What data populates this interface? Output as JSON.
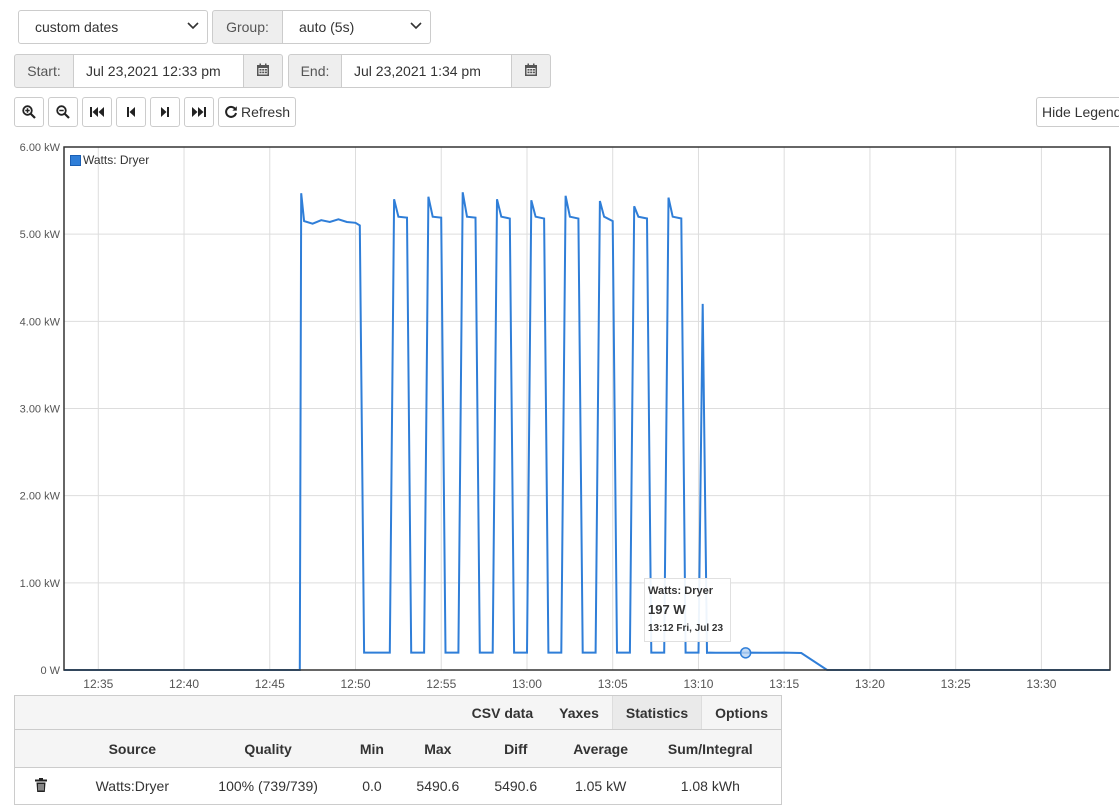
{
  "controls": {
    "range_select": "custom dates",
    "group_label": "Group:",
    "group_select": "auto (5s)",
    "start_label": "Start:",
    "start_value": "Jul 23,2021 12:33 pm",
    "end_label": "End:",
    "end_value": "Jul 23,2021 1:34 pm",
    "refresh_label": "Refresh",
    "hide_legend_label": "Hide Legend"
  },
  "icons": {
    "zoom_in": "zoom-in-icon",
    "zoom_out": "zoom-out-icon",
    "first": "skip-backward-icon",
    "prev": "step-backward-icon",
    "next": "step-forward-icon",
    "last": "skip-forward-icon",
    "refresh": "refresh-icon",
    "calendar": "calendar-icon",
    "trash": "trash-icon"
  },
  "chart_data": {
    "type": "line",
    "title": "",
    "xlabel": "",
    "ylabel": "",
    "x_ticks": [
      "12:35",
      "12:40",
      "12:45",
      "12:50",
      "12:55",
      "13:00",
      "13:05",
      "13:10",
      "13:15",
      "13:20",
      "13:25",
      "13:30"
    ],
    "y_ticks": [
      "0 W",
      "1.00 kW",
      "2.00 kW",
      "3.00 kW",
      "4.00 kW",
      "5.00 kW",
      "6.00 kW"
    ],
    "xlim": [
      "12:33",
      "13:34"
    ],
    "ylim": [
      0,
      6000
    ],
    "grid": true,
    "legend": "top-left",
    "color": "#2f7ed8",
    "series": [
      {
        "name": "Watts: Dryer",
        "x": [
          "12:33",
          "12:46:45",
          "12:46:50",
          "12:47",
          "12:47:30",
          "12:48",
          "12:48:30",
          "12:49",
          "12:49:30",
          "12:50",
          "12:50:15",
          "12:50:30",
          "12:50:40",
          "12:52",
          "12:52:15",
          "12:52:30",
          "12:53",
          "12:53:15",
          "12:53:25",
          "12:54",
          "12:54:15",
          "12:54:30",
          "12:55",
          "12:55:15",
          "12:55:25",
          "12:56",
          "12:56:15",
          "12:56:30",
          "12:57",
          "12:57:15",
          "12:57:25",
          "12:58",
          "12:58:15",
          "12:58:30",
          "12:59",
          "12:59:15",
          "12:59:25",
          "13:00",
          "13:00:15",
          "13:00:30",
          "13:01",
          "13:01:15",
          "13:01:25",
          "13:02",
          "13:02:15",
          "13:02:30",
          "13:03",
          "13:03:15",
          "13:03:25",
          "13:04",
          "13:04:15",
          "13:04:30",
          "13:05",
          "13:05:15",
          "13:05:25",
          "13:06",
          "13:06:15",
          "13:06:30",
          "13:07",
          "13:07:15",
          "13:07:25",
          "13:08",
          "13:08:15",
          "13:08:30",
          "13:09",
          "13:09:15",
          "13:09:25",
          "13:10",
          "13:10:15",
          "13:10:30",
          "13:10:40",
          "13:11",
          "13:12",
          "13:13",
          "13:14",
          "13:15",
          "13:16",
          "13:17:30",
          "13:17:40",
          "13:34"
        ],
        "y": [
          0,
          0,
          5470,
          5150,
          5120,
          5160,
          5140,
          5170,
          5140,
          5130,
          5100,
          200,
          200,
          200,
          5400,
          5200,
          5190,
          200,
          200,
          200,
          5430,
          5200,
          5190,
          200,
          200,
          200,
          5480,
          5200,
          5190,
          200,
          200,
          200,
          5400,
          5200,
          5180,
          200,
          200,
          200,
          5390,
          5200,
          5180,
          200,
          200,
          200,
          5440,
          5200,
          5180,
          200,
          200,
          200,
          5380,
          5200,
          5150,
          200,
          200,
          200,
          5320,
          5200,
          5180,
          200,
          200,
          200,
          5420,
          5200,
          5180,
          200,
          200,
          200,
          4200,
          197,
          200,
          197,
          197,
          200,
          197,
          200,
          195,
          0,
          0,
          0
        ],
        "unit": "W"
      }
    ],
    "tooltip": {
      "series": "Watts: Dryer",
      "value": "197 W",
      "time": "13:12 Fri, Jul 23",
      "x": "13:12:45",
      "y": 197
    }
  },
  "stats_panel": {
    "tabs": [
      "CSV data",
      "Yaxes",
      "Statistics",
      "Options"
    ],
    "active_tab": "Statistics",
    "columns": [
      "",
      "Source",
      "Quality",
      "Min",
      "Max",
      "Diff",
      "Average",
      "Sum/Integral"
    ],
    "rows": [
      {
        "source": "Watts:Dryer",
        "quality": "100% (739/739)",
        "min": "0.0",
        "max": "5490.6",
        "diff": "5490.6",
        "average": "1.05 kW",
        "sum": "1.08 kWh"
      }
    ]
  }
}
